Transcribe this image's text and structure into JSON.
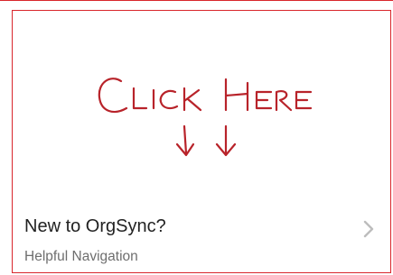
{
  "card": {
    "title": "New to OrgSync?",
    "subtitle": "Helpful Navigation",
    "handwritten_text": "Click Here",
    "border_color": "#d9262c",
    "handwriting_color": "#b8232a",
    "chevron_icon": "chevron-right-icon"
  }
}
